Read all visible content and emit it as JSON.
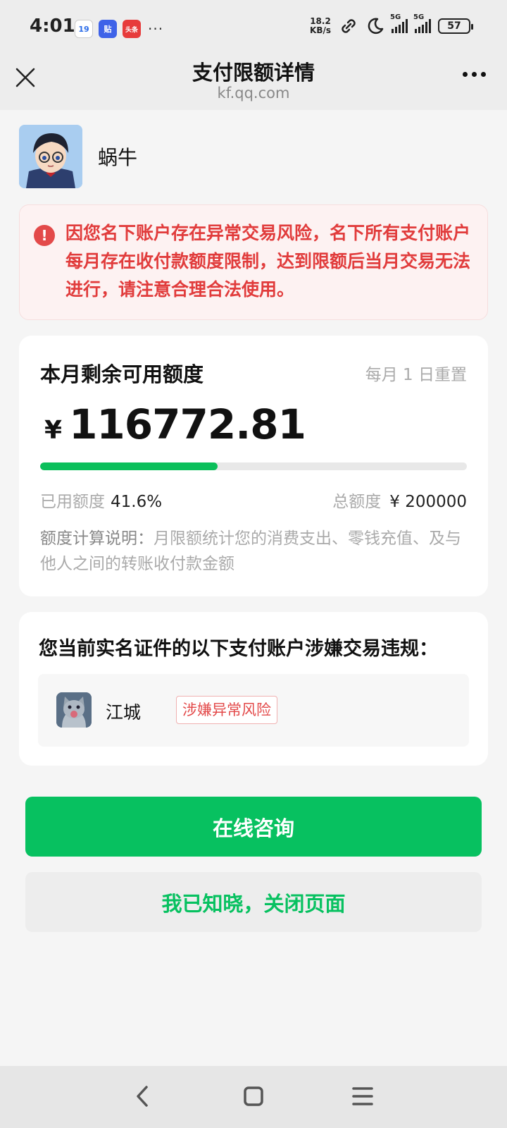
{
  "status_bar": {
    "time": "4:01",
    "calendar_icon_text": "19",
    "tieba_icon_text": "贴",
    "toutiao_icon_text": "头条",
    "more": "···",
    "net_speed_value": "18.2",
    "net_speed_unit": "KB/s",
    "signal1_label": "5G",
    "signal2_label": "5G",
    "battery": "57"
  },
  "header": {
    "title": "支付限额详情",
    "subtitle": "kf.qq.com"
  },
  "user": {
    "name": "蜗牛"
  },
  "warning": {
    "icon": "!",
    "text": "因您名下账户存在异常交易风险，名下所有支付账户每月存在收付款额度限制，达到限额后当月交易无法进行，请注意合理合法使用。"
  },
  "quota": {
    "title": "本月剩余可用额度",
    "reset_note": "每月 1 日重置",
    "currency": "¥",
    "remaining": "116772.81",
    "used_fraction": 0.416,
    "used_label": "已用额度",
    "used_value": "41.6%",
    "total_label": "总额度",
    "total_value": "¥ 200000",
    "explain_key": "额度计算说明：",
    "explain_text": "月限额统计您的消费支出、零钱充值、及与他人之间的转账收付款金额"
  },
  "violation": {
    "title": "您当前实名证件的以下支付账户涉嫌交易违规：",
    "account_name": "江城",
    "tag": "涉嫌异常风险"
  },
  "buttons": {
    "primary": "在线咨询",
    "secondary": "我已知晓，关闭页面"
  },
  "colors": {
    "brand_green": "#07c160",
    "warning_red": "#e13c3c",
    "background": "#f5f5f5"
  }
}
